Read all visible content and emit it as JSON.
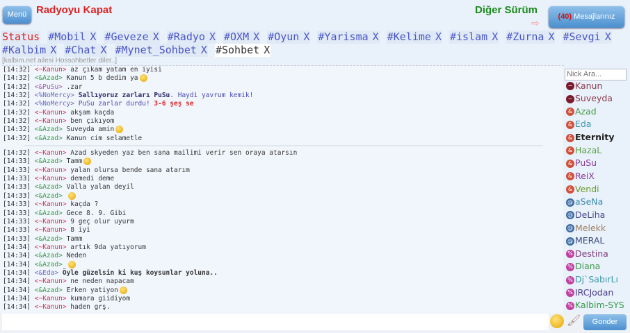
{
  "header": {
    "menu_label": "Menü",
    "radio_label": "Radyoyu Kapat",
    "other_version": "Diğer Sürüm",
    "messages_count": "(40)",
    "messages_label": " Mesajlarınız"
  },
  "tabs": [
    {
      "label": "Status",
      "closable": false,
      "type": "status"
    },
    {
      "label": "#Mobil"
    },
    {
      "label": "#Geveze"
    },
    {
      "label": "#Radyo"
    },
    {
      "label": "#OXM"
    },
    {
      "label": "#Oyun"
    },
    {
      "label": "#Yarisma"
    },
    {
      "label": "#Kelime"
    },
    {
      "label": "#islam"
    },
    {
      "label": "#Zurna"
    },
    {
      "label": "#Sevgi"
    },
    {
      "label": "#Kalbim"
    },
    {
      "label": "#Chat"
    },
    {
      "label": "#Mynet_Sohbet"
    },
    {
      "label": "#Sohbet",
      "type": "active"
    }
  ],
  "close_glyph": "X",
  "topic": "[kalbim.net ailesi Hossohbetler diler..]",
  "messages": [
    {
      "time": "[14:32]",
      "nick": "<~Kanun>",
      "nc": "n-red",
      "parts": [
        {
          "t": "az çıkam yatam en iyisi"
        }
      ]
    },
    {
      "time": "[14:32]",
      "nick": "<&Azad>",
      "nc": "n-green",
      "parts": [
        {
          "t": "Kanun 5 b dedim ya"
        }
      ],
      "smiley": true
    },
    {
      "time": "[14:32]",
      "nick": "<&PuSu>",
      "nc": "n-purple",
      "parts": [
        {
          "t": ".zar"
        }
      ]
    },
    {
      "time": "[14:32]",
      "nick": "<%NoMercy>",
      "nc": "n-blue",
      "parts": [
        {
          "t": "Sallıyoruz zarları PuSu",
          "c": "b-navy"
        },
        {
          "t": ". Haydi yavrum kemik!",
          "c": "c-blue"
        }
      ]
    },
    {
      "time": "[14:32]",
      "nick": "<%NoMercy>",
      "nc": "n-blue",
      "parts": [
        {
          "t": "PuSu zarlar durdu! ",
          "c": "c-blue"
        },
        {
          "t": "3-6 şeş se",
          "c": "c-red"
        }
      ]
    },
    {
      "time": "[14:32]",
      "nick": "<~Kanun>",
      "nc": "n-red",
      "parts": [
        {
          "t": "akşam kaçda"
        }
      ]
    },
    {
      "time": "[14:32]",
      "nick": "<~Kanun>",
      "nc": "n-red",
      "parts": [
        {
          "t": "ben çıkıyom"
        }
      ]
    },
    {
      "time": "[14:32]",
      "nick": "<&Azad>",
      "nc": "n-green",
      "parts": [
        {
          "t": "Suveyda amin"
        }
      ],
      "smiley": true
    },
    {
      "time": "[14:32]",
      "nick": "<&Azad>",
      "nc": "n-green",
      "parts": [
        {
          "t": "Kanun cim selametle"
        }
      ],
      "sep": true
    },
    {
      "time": "[14:32]",
      "nick": "<~Kanun>",
      "nc": "n-red",
      "parts": [
        {
          "t": "Azad skyeden yaz ben sana mailimi verir sen oraya atarsın"
        }
      ]
    },
    {
      "time": "[14:33]",
      "nick": "<&Azad>",
      "nc": "n-green",
      "parts": [
        {
          "t": "Tamm"
        }
      ],
      "smiley": true
    },
    {
      "time": "[14:33]",
      "nick": "<~Kanun>",
      "nc": "n-red",
      "parts": [
        {
          "t": "yalan olursa bende sana atarım"
        }
      ]
    },
    {
      "time": "[14:33]",
      "nick": "<~Kanun>",
      "nc": "n-red",
      "parts": [
        {
          "t": "demedi deme"
        }
      ]
    },
    {
      "time": "[14:33]",
      "nick": "<&Azad>",
      "nc": "n-green",
      "parts": [
        {
          "t": "Valla yalan deyil"
        }
      ]
    },
    {
      "time": "[14:33]",
      "nick": "<&Azad>",
      "nc": "n-green",
      "parts": [],
      "smiley": true
    },
    {
      "time": "[14:33]",
      "nick": "<~Kanun>",
      "nc": "n-red",
      "parts": [
        {
          "t": "kaçda ?"
        }
      ]
    },
    {
      "time": "[14:33]",
      "nick": "<&Azad>",
      "nc": "n-green",
      "parts": [
        {
          "t": "Gece 8. 9. Gibi"
        }
      ]
    },
    {
      "time": "[14:33]",
      "nick": "<~Kanun>",
      "nc": "n-red",
      "parts": [
        {
          "t": "9 geç olur uyurm"
        }
      ]
    },
    {
      "time": "[14:33]",
      "nick": "<~Kanun>",
      "nc": "n-red",
      "parts": [
        {
          "t": "8 iyi"
        }
      ]
    },
    {
      "time": "[14:33]",
      "nick": "<&Azad>",
      "nc": "n-green",
      "parts": [
        {
          "t": "Tamm"
        }
      ]
    },
    {
      "time": "[14:34]",
      "nick": "<~Kanun>",
      "nc": "n-red",
      "parts": [
        {
          "t": "artık 9da yatıyorum"
        }
      ]
    },
    {
      "time": "[14:34]",
      "nick": "<&Azad>",
      "nc": "n-green",
      "parts": [
        {
          "t": "Neden"
        }
      ]
    },
    {
      "time": "[14:34]",
      "nick": "<&Azad>",
      "nc": "n-green",
      "parts": [],
      "smiley": true
    },
    {
      "time": "[14:34]",
      "nick": "<&Eda>",
      "nc": "n-blue",
      "parts": [
        {
          "t": "Öyle güzelsin ki kuş koysunlar yoluna..",
          "c": "bold"
        }
      ]
    },
    {
      "time": "[14:34]",
      "nick": "<~Kanun>",
      "nc": "n-red",
      "parts": [
        {
          "t": "ne neden napacam"
        }
      ]
    },
    {
      "time": "[14:34]",
      "nick": "<&Azad>",
      "nc": "n-green",
      "parts": [
        {
          "t": "Erken yatiyon"
        }
      ],
      "smiley": true
    },
    {
      "time": "[14:34]",
      "nick": "<~Kanun>",
      "nc": "n-red",
      "parts": [
        {
          "t": "kumara giidiyom"
        }
      ]
    },
    {
      "time": "[14:34]",
      "nick": "<~Kanun>",
      "nc": "n-red",
      "parts": [
        {
          "t": "haden grş."
        }
      ]
    }
  ],
  "nicklist": {
    "placeholder": "Nick Ara...",
    "users": [
      {
        "name": "Kanun",
        "mode": "~",
        "color": "#8b3a4a"
      },
      {
        "name": "Suveyda",
        "mode": "~",
        "color": "#8b3a4a"
      },
      {
        "name": "Azad",
        "mode": "&",
        "color": "#4a9a4a"
      },
      {
        "name": "Eda",
        "mode": "&",
        "color": "#3a9aaa"
      },
      {
        "name": "Eternity",
        "mode": "&",
        "color": "#222",
        "bold": true
      },
      {
        "name": "HazaL",
        "mode": "&",
        "color": "#5aa04a"
      },
      {
        "name": "PuSu",
        "mode": "&",
        "color": "#8a3a9a"
      },
      {
        "name": "ReiX",
        "mode": "&",
        "color": "#8a3a9a"
      },
      {
        "name": "Vendi",
        "mode": "&",
        "color": "#6a9a2a"
      },
      {
        "name": "aSeNa",
        "mode": "@",
        "color": "#3a8aaa"
      },
      {
        "name": "DeLiha",
        "mode": "@",
        "color": "#4a4a8a"
      },
      {
        "name": "Melekk",
        "mode": "@",
        "color": "#a08060"
      },
      {
        "name": "MERAL",
        "mode": "@",
        "color": "#3a4a7a"
      },
      {
        "name": "Destina",
        "mode": "%",
        "color": "#7a3a7a"
      },
      {
        "name": "Diana",
        "mode": "%",
        "color": "#3a9a4a"
      },
      {
        "name": "Dj`SabırLı",
        "mode": "%",
        "color": "#3a9aaa"
      },
      {
        "name": "IRCJodan",
        "mode": "%",
        "color": "#4a3a8a"
      },
      {
        "name": "Kalbim-SYS",
        "mode": "%",
        "color": "#3a9a4a"
      }
    ]
  },
  "mode_colors": {
    "~": "#7a1a2a",
    "&": "#d0503a",
    "@": "#3a6aa0",
    "%": "#c040a0"
  },
  "composer": {
    "send_label": "Gonder"
  }
}
